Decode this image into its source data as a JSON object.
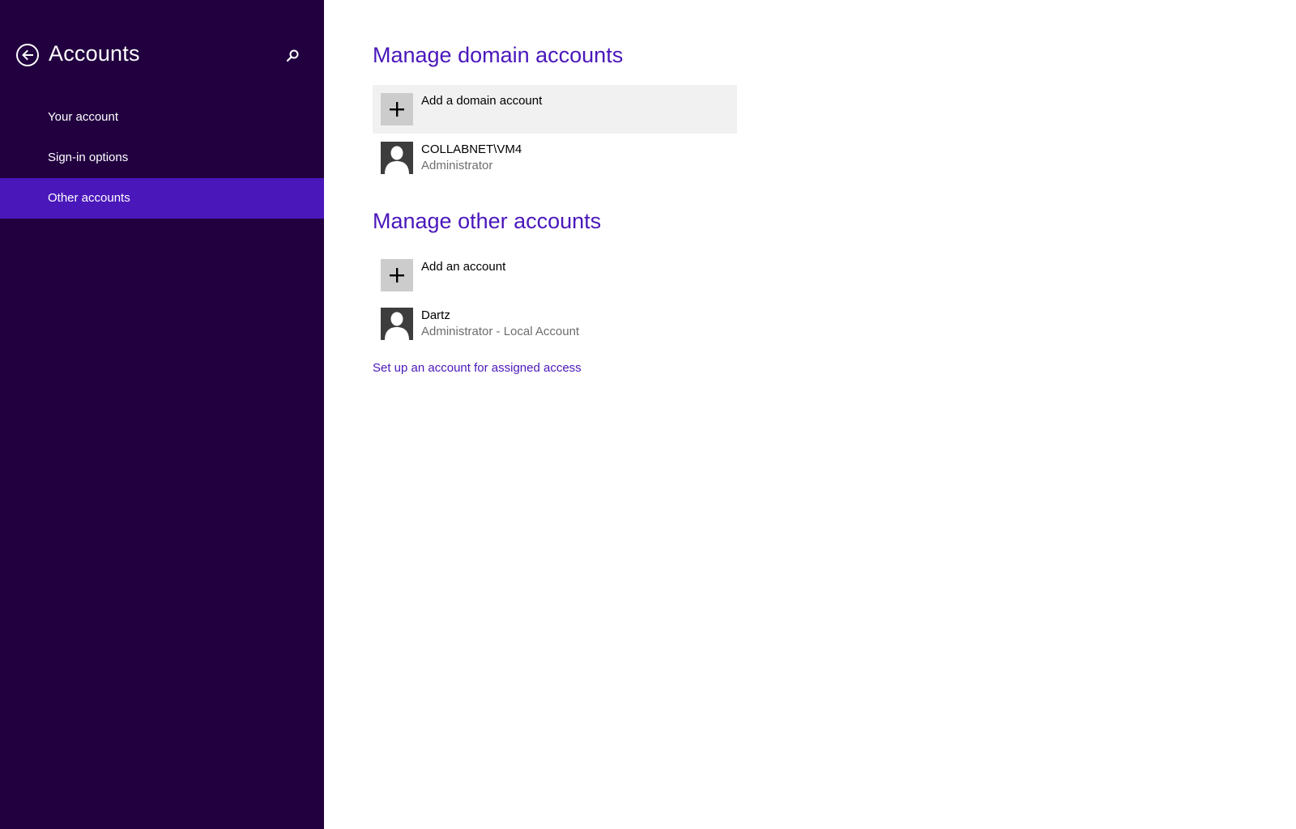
{
  "colors": {
    "sidebar_bg": "#220040",
    "accent": "#4a17bb",
    "active_item_bg": "#4a17bb",
    "hover_row_bg": "#f1f1f1",
    "tile_bg": "#cccccc",
    "avatar_bg": "#3d3d3d",
    "sub_text": "#6d6d6d"
  },
  "sidebar": {
    "title": "Accounts",
    "back_icon": "back-arrow-icon",
    "search_icon": "search-icon",
    "items": [
      {
        "label": "Your account",
        "active": false
      },
      {
        "label": "Sign-in options",
        "active": false
      },
      {
        "label": "Other accounts",
        "active": true
      }
    ]
  },
  "main": {
    "domain_section": {
      "title": "Manage domain accounts",
      "add_label": "Add a domain account",
      "accounts": [
        {
          "name": "COLLABNET\\VM4",
          "role": "Administrator"
        }
      ]
    },
    "other_section": {
      "title": "Manage other accounts",
      "add_label": "Add an account",
      "accounts": [
        {
          "name": "Dartz",
          "role": "Administrator - Local Account"
        }
      ]
    },
    "assigned_access_link": "Set up an account for assigned access"
  }
}
